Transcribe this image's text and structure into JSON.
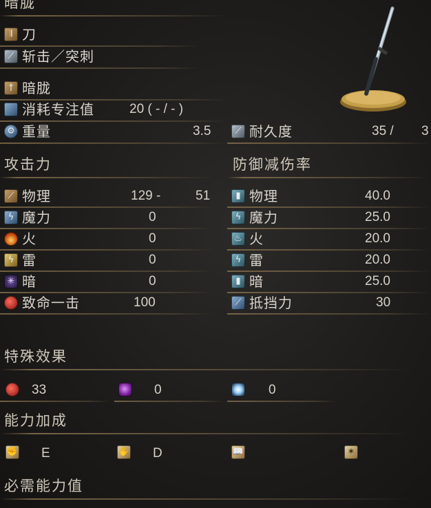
{
  "weapon_name": "暗胧",
  "weapon_type": "刀",
  "attack_type": "斩击／突刺",
  "skill_name": "暗胧",
  "fp_cost": {
    "label": "消耗专注值",
    "value": "20 (  - /  - )"
  },
  "weight": {
    "label": "重量",
    "value": "3.5"
  },
  "durability": {
    "label": "耐久度",
    "value": "35 /",
    "max": "3"
  },
  "attack": {
    "title": "攻击力",
    "rows": [
      {
        "label": "物理",
        "value": "129 -",
        "bonus": "51"
      },
      {
        "label": "魔力",
        "value": "0"
      },
      {
        "label": "火",
        "value": "0"
      },
      {
        "label": "雷",
        "value": "0"
      },
      {
        "label": "暗",
        "value": "0"
      },
      {
        "label": "致命一击",
        "value": "100"
      }
    ]
  },
  "defense": {
    "title": "防御减伤率",
    "rows": [
      {
        "label": "物理",
        "value": "40.0"
      },
      {
        "label": "魔力",
        "value": "25.0"
      },
      {
        "label": "火",
        "value": "20.0"
      },
      {
        "label": "雷",
        "value": "20.0"
      },
      {
        "label": "暗",
        "value": "25.0"
      },
      {
        "label": "抵挡力",
        "value": "30"
      }
    ]
  },
  "effects": {
    "title": "特殊效果",
    "items": [
      {
        "value": "33"
      },
      {
        "value": "0"
      },
      {
        "value": "0"
      }
    ]
  },
  "scaling": {
    "title": "能力加成",
    "items": [
      {
        "grade": "E"
      },
      {
        "grade": "D"
      },
      {
        "grade": ""
      },
      {
        "grade": ""
      }
    ]
  },
  "requirements": {
    "title": "必需能力值"
  },
  "colors": {
    "accent_line": "#8c7450",
    "text": "#d8d4cc",
    "background": "#1d1c1b"
  }
}
